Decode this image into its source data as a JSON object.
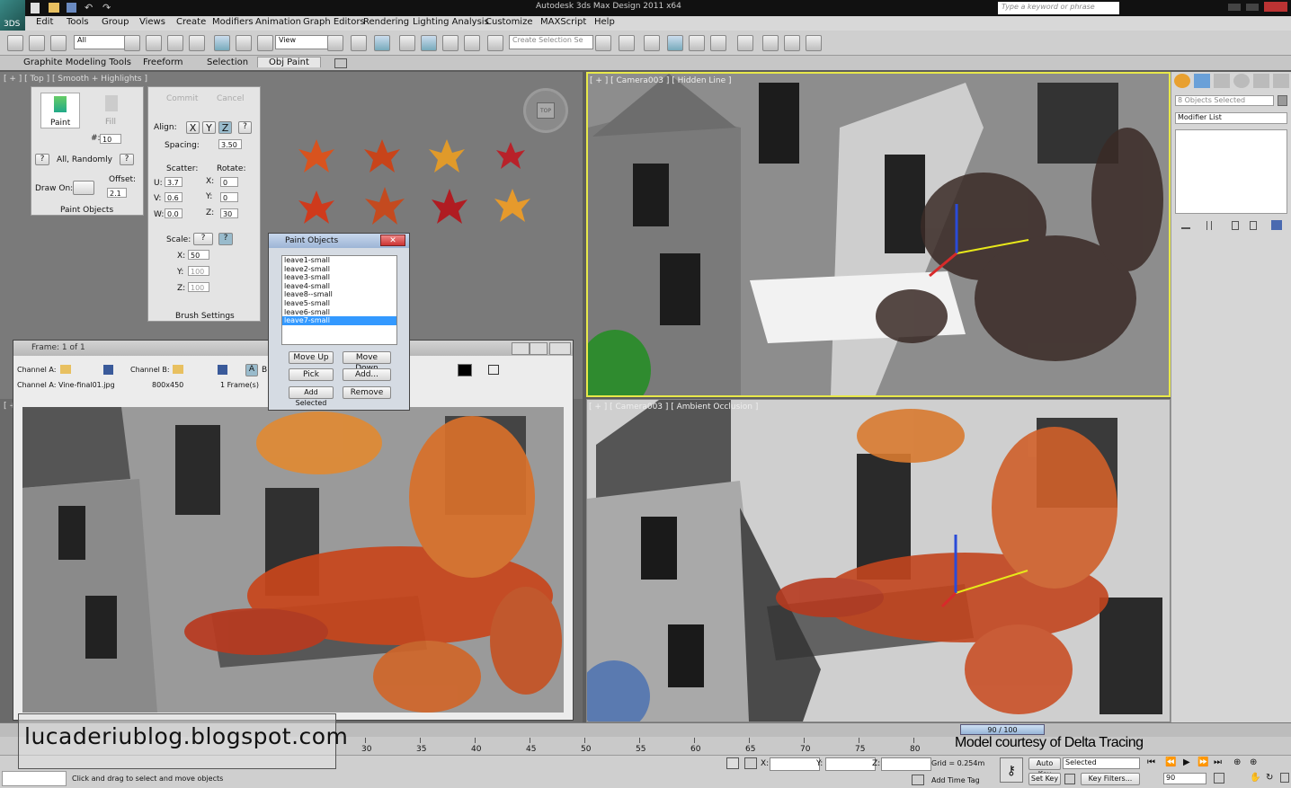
{
  "app": {
    "window_title": "Autodesk 3ds Max Design 2011 x64",
    "search_placeholder": "Type a keyword or phrase",
    "logo": "3DS"
  },
  "menu": [
    "Edit",
    "Tools",
    "Group",
    "Views",
    "Create",
    "Modifiers",
    "Animation",
    "Graph Editors",
    "Rendering",
    "Lighting Analysis",
    "Customize",
    "MAXScript",
    "Help"
  ],
  "toolbar": {
    "selection_filter": "All",
    "ref_coord": "View",
    "named_selection_placeholder": "Create Selection Se"
  },
  "ribbon_tabs": [
    "Graphite Modeling Tools",
    "Freeform",
    "Selection",
    "Obj Paint"
  ],
  "viewports": {
    "top_label": "[ + ] [ Top ] [ Smooth + Highlights ]",
    "camera_label": "[ + ] [ Camera003 ] [ Hidden Line ]",
    "ao_label": "[ + ] [ Camera003 ] [ Ambient Occlusion ]",
    "bottom_left_label": "[ + ]",
    "viewcube_label": "TOP"
  },
  "paint_panel": {
    "paint": "Paint",
    "fill": "Fill",
    "count_label": "#:",
    "count": "10",
    "order": "All, Randomly",
    "draw_on": "Draw On:",
    "offset_label": "Offset:",
    "offset": "2.1",
    "title": "Paint Objects"
  },
  "brush_panel": {
    "commit": "Commit",
    "cancel": "Cancel",
    "align_label": "Align:",
    "axis_x": "X",
    "axis_y": "Y",
    "axis_z": "Z",
    "help": "?",
    "spacing_label": "Spacing:",
    "spacing": "3.50",
    "scatter_label": "Scatter:",
    "rotate_label": "Rotate:",
    "u_label": "U:",
    "u": "3.7",
    "v_label": "V:",
    "v": "0.6",
    "w_label": "W:",
    "w": "0.0",
    "rx_label": "X:",
    "rx": "0",
    "ry_label": "Y:",
    "ry": "0",
    "rz_label": "Z:",
    "rz": "30",
    "scale_label": "Scale:",
    "sx_label": "X:",
    "sx": "50",
    "sy_label": "Y:",
    "sy": "100",
    "sz_label": "Z:",
    "sz": "100",
    "title": "Brush Settings"
  },
  "paint_dialog": {
    "title": "Paint Objects",
    "items": [
      "leave1-small",
      "leave2-small",
      "leave3-small",
      "leave4-small",
      "leave8--small",
      "leave5-small",
      "leave6-small",
      "leave7-small"
    ],
    "selected_index": 7,
    "move_up": "Move Up",
    "move_down": "Move Down",
    "pick": "Pick",
    "add": "Add...",
    "add_selected": "Add Selected",
    "remove": "Remove"
  },
  "frame_window": {
    "title": "Frame: 1 of 1",
    "channel_a_label": "Channel A:",
    "channel_b_label": "Channel B:",
    "channel_a_file": "Channel A: Vine-final01.jpg",
    "resolution": "800x450",
    "frames": "1 Frame(s)",
    "a_button": "A",
    "b_button": "B"
  },
  "command_panel": {
    "objects_selected": "8 Objects Selected",
    "modifier_list": "Modifier List"
  },
  "timeline": {
    "frame_display": "90 / 100",
    "ticks": [
      "30",
      "35",
      "40",
      "45",
      "50",
      "55",
      "60",
      "65",
      "70",
      "75",
      "80"
    ]
  },
  "status": {
    "prompt": "Click and drag to select and move objects",
    "x_label": "X:",
    "y_label": "Y:",
    "z_label": "Z:",
    "grid": "Grid = 0.254m",
    "add_time_tag": "Add Time Tag",
    "auto_key": "Auto Key",
    "set_key": "Set Key",
    "key_mode": "Selected",
    "key_filters": "Key Filters...",
    "current_frame": "90"
  },
  "overlays": {
    "blog": "lucaderiublog.blogspot.com",
    "credit": "Model courtesy of Delta Tracing"
  },
  "colors": {
    "active_viewport": "#e8e84a",
    "selection": "#3399ff"
  }
}
